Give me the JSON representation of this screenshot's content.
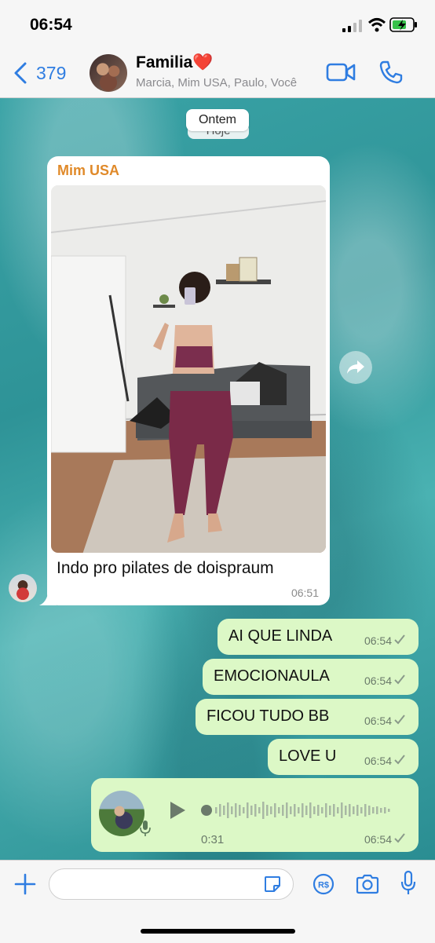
{
  "status_bar": {
    "time": "06:54"
  },
  "header": {
    "back_count": "379",
    "title": "Familia❤️",
    "subtitle": "Marcia, Mim USA, Paulo, Você"
  },
  "chat": {
    "date_pill": "Ontem",
    "date_pill_under": "Hoje",
    "incoming": {
      "sender": "Mim USA",
      "caption": "Indo pro pilates de doispraum",
      "time": "06:51"
    },
    "outgoing": [
      {
        "text": "AI QUE LINDA",
        "time": "06:54"
      },
      {
        "text": "EMOCIONAULA",
        "time": "06:54"
      },
      {
        "text": "FICOU TUDO BB",
        "time": "06:54"
      },
      {
        "text": "LOVE U",
        "time": "06:54"
      }
    ],
    "voice_note": {
      "duration": "0:31",
      "time": "06:54"
    }
  },
  "colors": {
    "accent": "#2f7de1",
    "sender": "#e08a2a",
    "outgoing_bubble": "#dcf8c6"
  },
  "icons": [
    "back-chevron",
    "video-call-icon",
    "phone-icon",
    "forward-icon",
    "plus-icon",
    "sticker-icon",
    "payment-icon",
    "camera-icon",
    "mic-icon"
  ]
}
